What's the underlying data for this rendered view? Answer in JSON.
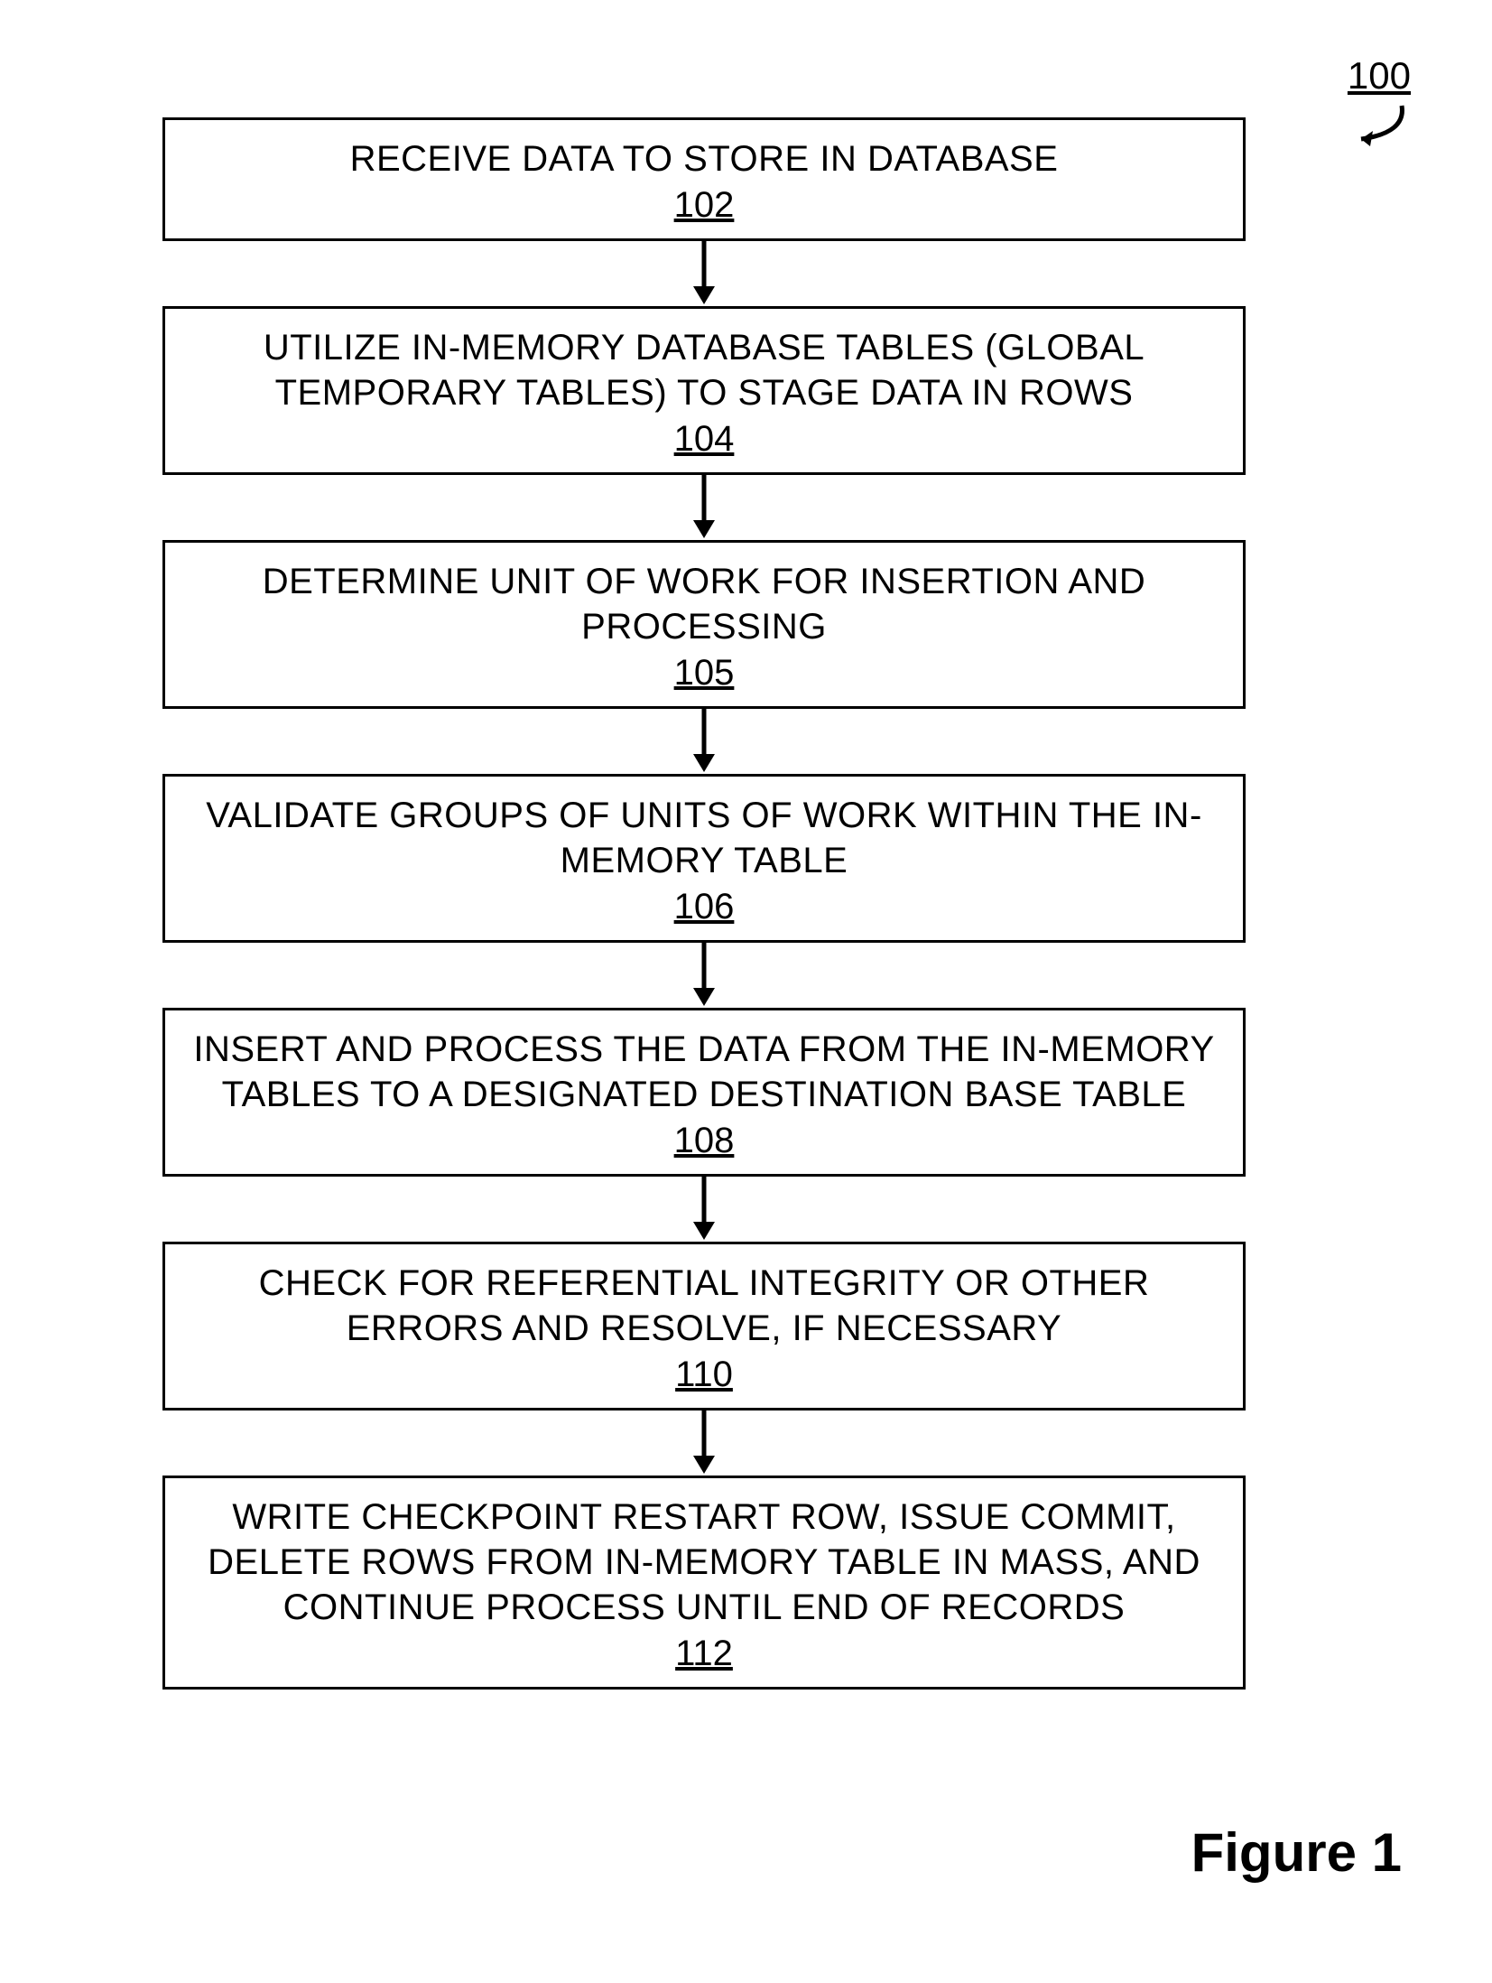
{
  "reference": {
    "number": "100"
  },
  "steps": [
    {
      "text": "RECEIVE DATA TO STORE IN DATABASE",
      "num": "102"
    },
    {
      "text": "UTILIZE IN-MEMORY DATABASE TABLES (GLOBAL TEMPORARY TABLES) TO STAGE DATA IN ROWS",
      "num": "104"
    },
    {
      "text": "DETERMINE UNIT OF WORK FOR INSERTION AND PROCESSING",
      "num": "105"
    },
    {
      "text": "VALIDATE GROUPS OF UNITS OF WORK WITHIN THE IN-MEMORY TABLE",
      "num": "106"
    },
    {
      "text": "INSERT AND PROCESS THE DATA FROM THE IN-MEMORY TABLES TO A DESIGNATED DESTINATION BASE TABLE",
      "num": "108"
    },
    {
      "text": "CHECK FOR REFERENTIAL INTEGRITY OR OTHER ERRORS AND RESOLVE, IF NECESSARY",
      "num": "110"
    },
    {
      "text": "WRITE CHECKPOINT RESTART ROW, ISSUE COMMIT, DELETE ROWS FROM IN-MEMORY TABLE IN MASS, AND CONTINUE PROCESS UNTIL END OF RECORDS",
      "num": "112"
    }
  ],
  "figure_label": "Figure 1"
}
